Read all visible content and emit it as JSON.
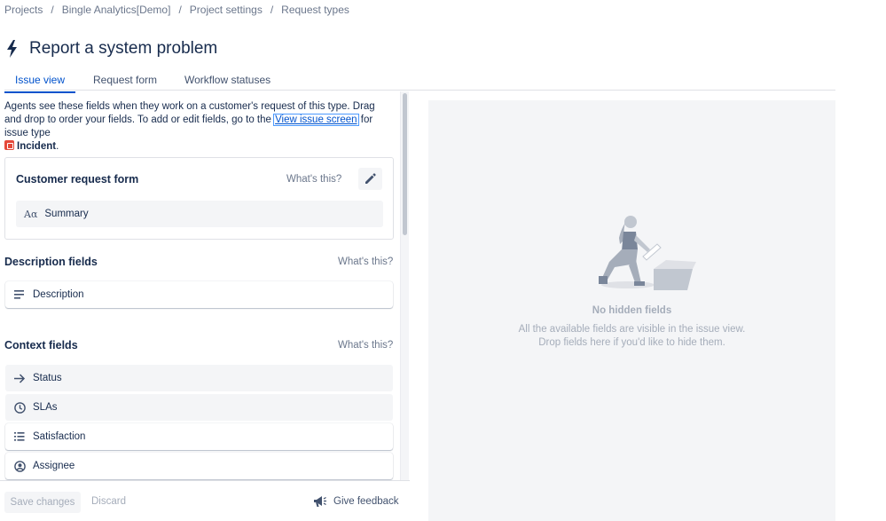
{
  "breadcrumb": [
    "Projects",
    "Bingle Analytics[Demo]",
    "Project settings",
    "Request types"
  ],
  "page": {
    "title": "Report a system problem"
  },
  "tabs": [
    {
      "label": "Issue view",
      "active": true
    },
    {
      "label": "Request form",
      "active": false
    },
    {
      "label": "Workflow statuses",
      "active": false
    }
  ],
  "intro": {
    "part1": "Agents see these fields when they work on a customer's request of this type. Drag and drop to order your fields. To add or edit fields, go to the ",
    "link": "View issue screen",
    "part2": " for issue type ",
    "issue_type": "Incident",
    "part3": "."
  },
  "customer_request_form": {
    "title": "Customer request form",
    "whats_this": "What's this?",
    "fields": [
      {
        "label": "Summary",
        "icon": "text-field-icon"
      }
    ]
  },
  "description_fields": {
    "title": "Description fields",
    "whats_this": "What's this?",
    "fields": [
      {
        "label": "Description",
        "icon": "paragraph-icon"
      }
    ]
  },
  "context_fields": {
    "title": "Context fields",
    "whats_this": "What's this?",
    "fields": [
      {
        "label": "Status",
        "icon": "arrow-right-icon"
      },
      {
        "label": "SLAs",
        "icon": "clock-icon"
      },
      {
        "label": "Satisfaction",
        "icon": "list-icon"
      },
      {
        "label": "Assignee",
        "icon": "user-avatar-icon"
      }
    ]
  },
  "footer": {
    "save": "Save changes",
    "discard": "Discard",
    "feedback": "Give feedback"
  },
  "hidden_panel": {
    "title": "No hidden fields",
    "line1": "All the available fields are visible in the issue view.",
    "line2": "Drop fields here if you'd like to hide them."
  },
  "colors": {
    "accent": "#0052cc",
    "text": "#172b4d",
    "muted": "#6b778c",
    "panel": "#f4f5f7",
    "incident": "#e5493a"
  }
}
